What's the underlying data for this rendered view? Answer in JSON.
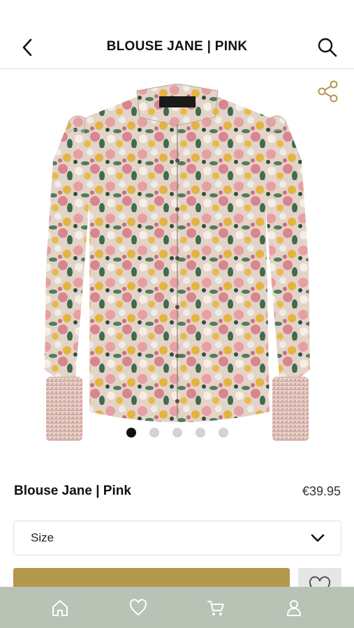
{
  "header": {
    "title": "BLOUSE JANE | PINK",
    "back_icon": "chevron-left-icon",
    "search_icon": "search-icon"
  },
  "gallery": {
    "share_icon": "share-icon",
    "image_description_icon": "blouse-photo",
    "slides_count": 5,
    "active_slide": 1
  },
  "product": {
    "name": "Blouse Jane | Pink",
    "price": "€39.95"
  },
  "size_select": {
    "label": "Size",
    "icon": "chevron-down-icon"
  },
  "actions": {
    "add_label": "",
    "wishlist_icon": "heart-icon"
  },
  "tabbar": {
    "items": [
      {
        "icon": "home-icon"
      },
      {
        "icon": "heart-icon"
      },
      {
        "icon": "cart-icon"
      },
      {
        "icon": "user-icon"
      }
    ]
  },
  "colors": {
    "accent": "#b5974b",
    "tabbar": "#b9c3b5",
    "share_icon": "#b5974b"
  }
}
